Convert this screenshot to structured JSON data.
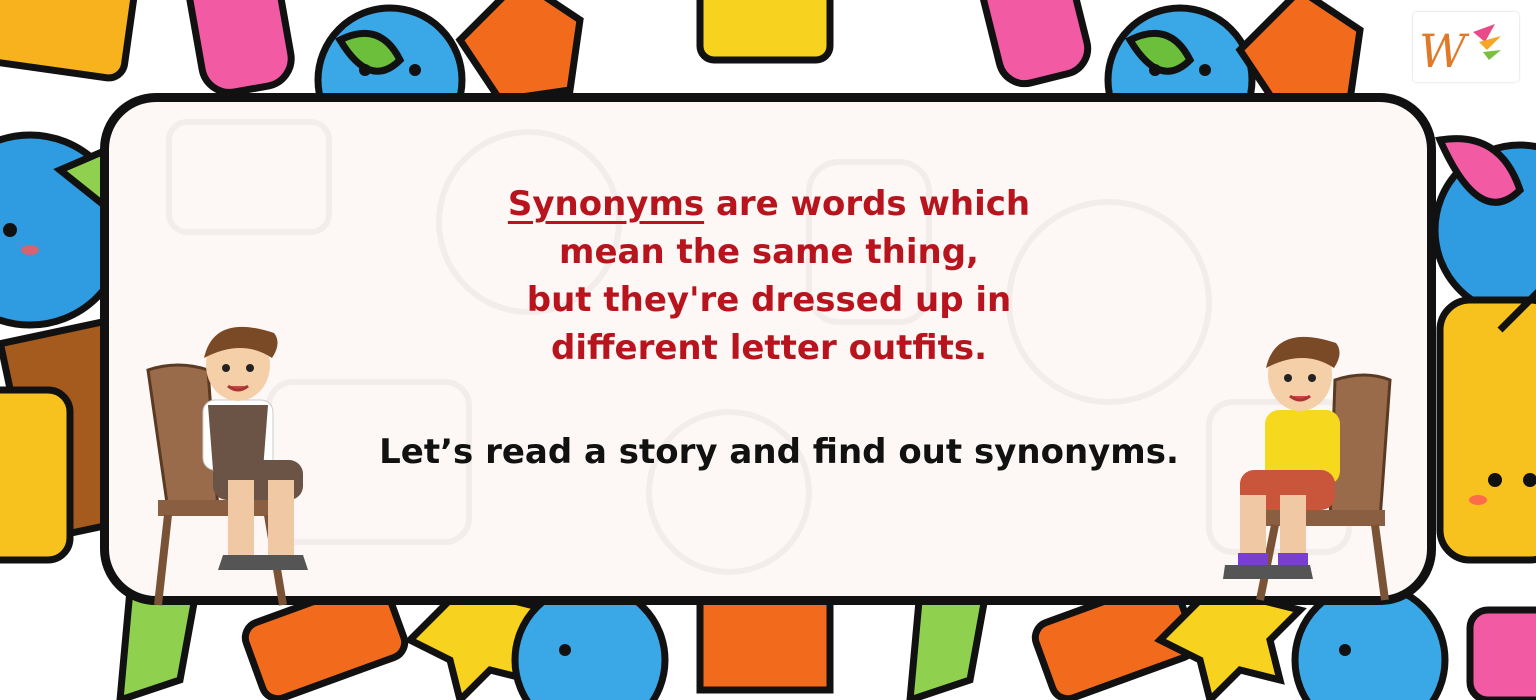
{
  "definition": {
    "keyword": "Synonyms",
    "line1_rest": " are words which",
    "line2": "mean the same thing,",
    "line3": "but they're dressed up in",
    "line4": "different letter outfits."
  },
  "prompt": "Let’s read a story and find out synonyms.",
  "colors": {
    "definition_text": "#b8141e",
    "prompt_text": "#111111",
    "card_border": "#111111",
    "card_fill": "#fdf8f5"
  },
  "icons": [
    "brand-logo-icon",
    "boy-on-chair-left",
    "boy-on-chair-right"
  ]
}
